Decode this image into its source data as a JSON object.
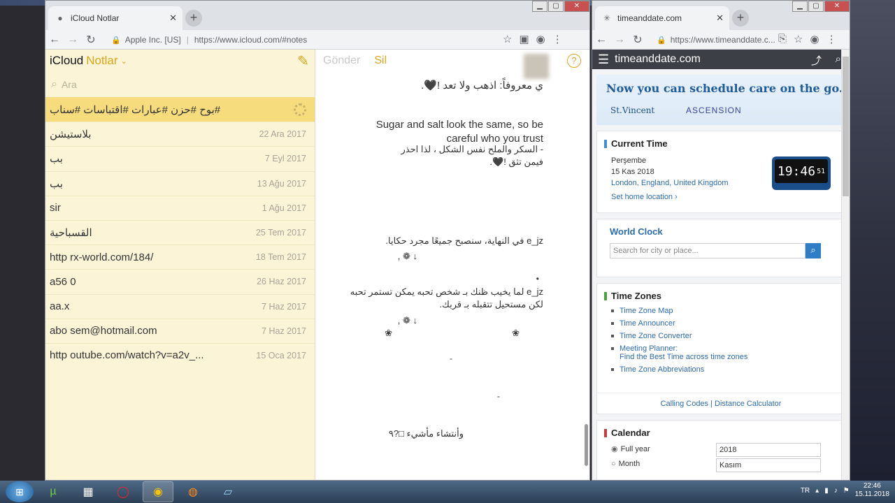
{
  "browser_left": {
    "tab_title": "iCloud Notlar",
    "site_identity": "Apple Inc. [US]",
    "url": "https://www.icloud.com/#notes"
  },
  "notes": {
    "brand": "iCloud",
    "app_name": "Notlar",
    "search_placeholder": "Ara",
    "items": [
      {
        "title": "#بوح #حزن #عبارات #اقتباسات #سناب",
        "date": ""
      },
      {
        "title": "بلاستيشن",
        "date": "22 Ara 2017"
      },
      {
        "title": "بب",
        "date": "7 Eyl 2017"
      },
      {
        "title": "بب",
        "date": "13 Ağu 2017"
      },
      {
        "title": "sir",
        "date": "1 Ağu 2017"
      },
      {
        "title": "القسباحية",
        "date": "25 Tem 2017"
      },
      {
        "title": "http rx-world.com/184/",
        "date": "18 Tem 2017"
      },
      {
        "title": "a56 0",
        "date": "26 Haz 2017"
      },
      {
        "title": "aa.x",
        "date": "7 Haz 2017"
      },
      {
        "title": "abo sem@hotmail.com",
        "date": "7 Haz 2017"
      },
      {
        "title": "http outube.com/watch?v=a2v_...",
        "date": "15 Oca 2017"
      }
    ],
    "editor": {
      "send_label": "Gönder",
      "delete_label": "Sil",
      "help_label": "?",
      "line1": "ي معروفاً: اذهب ولا تعد !🖤.",
      "line2_en": "Sugar and salt look the same, so be careful who you trust",
      "line2_ar": "- السكر والملح نفس الشكل ، لذا احذر فيمن تثق !🖤.",
      "line3": "e_jz في النهاية، سنصبح جميعًا مجرد حكايا.",
      "line3b": "↓ ❁ ,",
      "line4_dot": "•",
      "line4": "e_jz لما يخيب ظنك بـ شخص تحبه يمكن تستمر تحبه لكن مستحيل تتقبله بـ قربك.",
      "line4b": "↓ ❁ ,",
      "line5a": "❀",
      "line5b": "❀",
      "line6": "-",
      "line7": "-",
      "line8": "وأنتشاء مأشيء □?٩"
    }
  },
  "browser_right": {
    "tab_title": "timeanddate.com",
    "url": "https://www.timeanddate.c...",
    "logo": "timeanddate.com",
    "ad_headline": "Now you can schedule care on the go.",
    "ad_brand1": "St.Vincent",
    "ad_brand2": "ASCENSION",
    "current_time": {
      "heading": "Current Time",
      "day": "Perşembe",
      "date": "15 Kas 2018",
      "location": "London, England, United Kingdom",
      "home_link": "Set home location",
      "time": "19:46",
      "seconds": "51"
    },
    "world_clock": {
      "heading": "World Clock",
      "placeholder": "Search for city or place..."
    },
    "time_zones": {
      "heading": "Time Zones",
      "links": [
        "Time Zone Map",
        "Time Announcer",
        "Time Zone Converter",
        "Meeting Planner:",
        "Find the Best Time across time zones",
        "Time Zone Abbreviations"
      ],
      "footer1": "Calling Codes",
      "footer2": "Distance Calculator"
    },
    "calendar": {
      "heading": "Calendar",
      "opt1": "Full year",
      "opt2": "Month",
      "year": "2018",
      "month": "Kasım"
    }
  },
  "taskbar": {
    "lang": "TR",
    "time": "22:46",
    "date": "15.11.2018"
  }
}
